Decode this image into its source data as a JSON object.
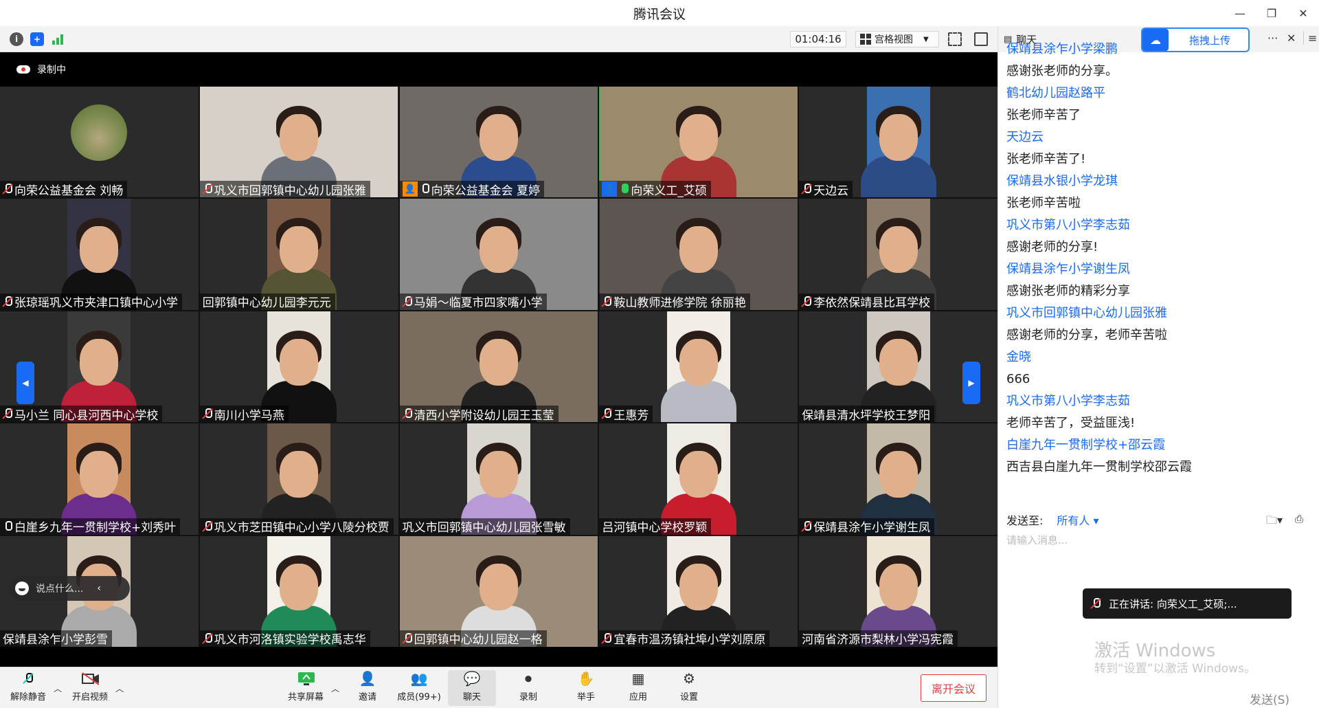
{
  "window": {
    "title": "腾讯会议",
    "controls": [
      "—",
      "❐",
      "✕"
    ]
  },
  "toolbar": {
    "timer": "01:04:16",
    "view_label": "宫格视图"
  },
  "stage": {
    "recording_label": "录制中",
    "say_placeholder": "说点什么..."
  },
  "participants": [
    {
      "name": "向荣公益基金会 刘畅",
      "mic": "muted",
      "badge": ""
    },
    {
      "name": "巩义市回郭镇中心幼儿园张雅",
      "mic": "muted",
      "badge": ""
    },
    {
      "name": "向荣公益基金会  夏婷",
      "mic": "on",
      "badge": "orange"
    },
    {
      "name": "向荣义工_艾硕",
      "mic": "active",
      "badge": "blue"
    },
    {
      "name": "天边云",
      "mic": "muted",
      "badge": ""
    },
    {
      "name": "张琼瑶巩义市夹津口镇中心小学",
      "mic": "muted",
      "badge": ""
    },
    {
      "name": "回郭镇中心幼儿园李元元",
      "mic": "none",
      "badge": ""
    },
    {
      "name": "马娟～临夏市四家嘴小学",
      "mic": "muted",
      "badge": ""
    },
    {
      "name": "鞍山教师进修学院 徐丽艳",
      "mic": "muted",
      "badge": ""
    },
    {
      "name": "李依然保靖县比耳学校",
      "mic": "muted",
      "badge": ""
    },
    {
      "name": "马小兰  同心县河西中心学校",
      "mic": "muted",
      "badge": ""
    },
    {
      "name": "南川小学马燕",
      "mic": "muted",
      "badge": ""
    },
    {
      "name": "清西小学附设幼儿园王玉莹",
      "mic": "muted",
      "badge": ""
    },
    {
      "name": "王惠芳",
      "mic": "muted",
      "badge": ""
    },
    {
      "name": "保靖县清水坪学校王梦阳",
      "mic": "none",
      "badge": ""
    },
    {
      "name": "白崖乡九年一贯制学校+刘秀叶",
      "mic": "on",
      "badge": ""
    },
    {
      "name": "巩义市芝田镇中心小学八陵分校贾",
      "mic": "muted",
      "badge": ""
    },
    {
      "name": "巩义市回郭镇中心幼儿园张雪敏",
      "mic": "none",
      "badge": ""
    },
    {
      "name": "吕河镇中心学校罗颖",
      "mic": "none",
      "badge": ""
    },
    {
      "name": "保靖县涂乍小学谢生凤",
      "mic": "muted",
      "badge": ""
    },
    {
      "name": "保靖县涂乍小学彭雪",
      "mic": "none",
      "badge": ""
    },
    {
      "name": "巩义市河洛镇实验学校禹志华",
      "mic": "muted",
      "badge": ""
    },
    {
      "name": "回郭镇中心幼儿园赵一格",
      "mic": "muted",
      "badge": ""
    },
    {
      "name": "宜春市温汤镇社埠小学刘原原",
      "mic": "muted",
      "badge": ""
    },
    {
      "name": "河南省济源市梨林小学冯宪霞",
      "mic": "none",
      "badge": ""
    }
  ],
  "bottom": {
    "unmute": "解除静音",
    "video": "开启视频",
    "share": "共享屏幕",
    "invite": "邀请",
    "members": "成员(99+)",
    "chat": "聊天",
    "record": "录制",
    "raise": "举手",
    "apps": "应用",
    "settings": "设置",
    "leave": "离开会议"
  },
  "chat": {
    "title": "聊天",
    "upload_label": "拖拽上传",
    "messages": [
      {
        "sender": "保靖县涂乍小学梁鹏",
        "text": "感谢张老师的分享。"
      },
      {
        "sender": "鹤北幼儿园赵路平",
        "text": "张老师辛苦了"
      },
      {
        "sender": "天边云",
        "text": "张老师辛苦了!"
      },
      {
        "sender": "保靖县水银小学龙琪",
        "text": "张老师辛苦啦"
      },
      {
        "sender": "巩义市第八小学李志茹",
        "text": "感谢老师的分享!"
      },
      {
        "sender": "保靖县涂乍小学谢生凤",
        "text": "感谢张老师的精彩分享"
      },
      {
        "sender": "巩义市回郭镇中心幼儿园张雅",
        "text": "感谢老师的分享，老师辛苦啦"
      },
      {
        "sender": "金晓",
        "text": "666"
      },
      {
        "sender": "巩义市第八小学李志茹",
        "text": "老师辛苦了，受益匪浅!"
      },
      {
        "sender": "白崖九年一贯制学校+邵云霞",
        "text": "西吉县白崖九年一贯制学校邵云霞"
      }
    ],
    "send_to_label": "发送至:",
    "send_to_target": "所有人",
    "input_placeholder": "请输入消息...",
    "speaking_label": "正在讲话: 向荣义工_艾硕;...",
    "watermark_title": "激活 Windows",
    "watermark_sub": "转到“设置”以激活 Windows。",
    "send_button": "发送(S)"
  }
}
